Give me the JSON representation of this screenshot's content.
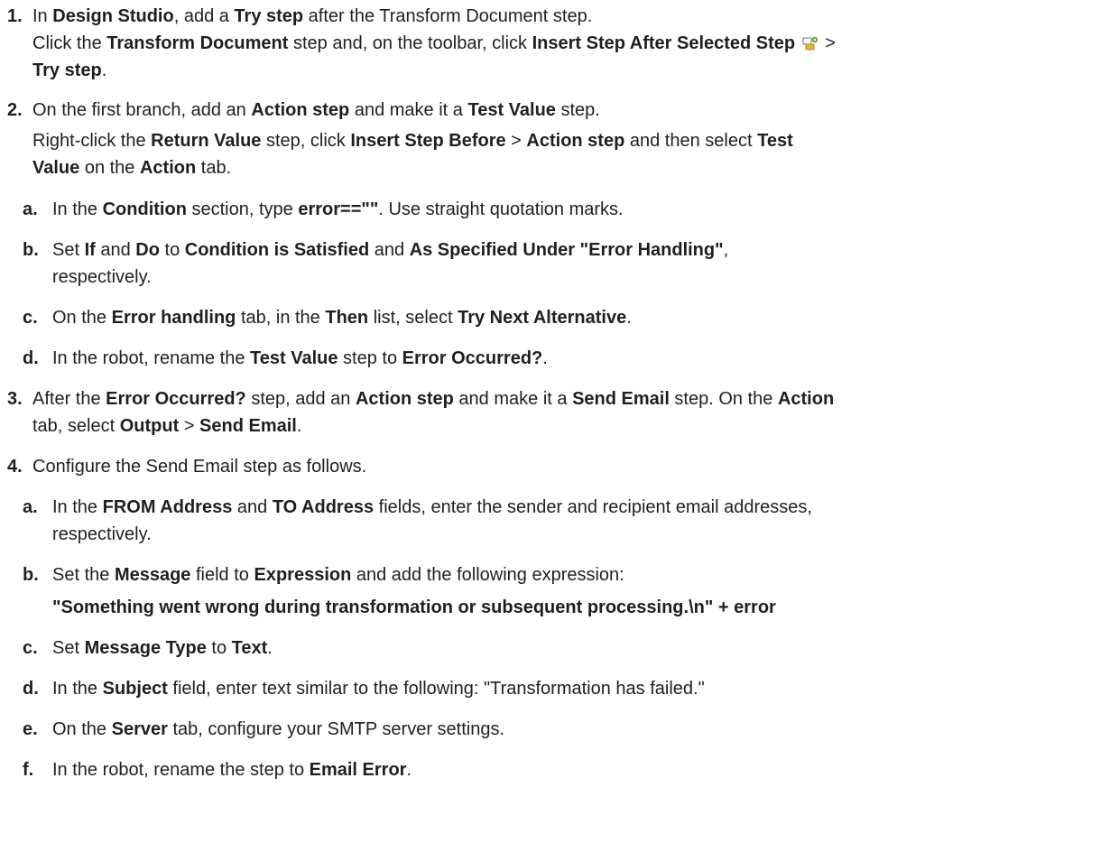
{
  "steps": [
    {
      "num": "1.",
      "line1": [
        "In ",
        "Design Studio",
        ", add a ",
        "Try step",
        " after the Transform Document step."
      ],
      "line2": [
        "Click the ",
        "Transform Document",
        " step and, on the toolbar, click ",
        "Insert Step After Selected Step",
        " ",
        " >"
      ],
      "line3": [
        "Try step",
        "."
      ]
    },
    {
      "num": "2.",
      "line1": [
        "On the first branch, add an ",
        "Action step",
        " and make it a ",
        "Test Value",
        " step."
      ],
      "line2": [
        "Right-click the ",
        "Return Value",
        " step, click ",
        "Insert Step Before",
        " > ",
        "Action step",
        " and then select ",
        "Test"
      ],
      "line3": [
        "Value",
        " on the ",
        "Action",
        " tab."
      ],
      "subs": [
        {
          "letter": "a.",
          "parts": [
            "In the ",
            "Condition",
            " section, type ",
            "error==\"\"",
            ". Use straight quotation marks."
          ]
        },
        {
          "letter": "b.",
          "parts": [
            "Set ",
            "If",
            " and ",
            "Do",
            " to ",
            "Condition is Satisfied",
            " and ",
            "As Specified Under \"Error Handling\"",
            ","
          ],
          "cont": "respectively."
        },
        {
          "letter": "c.",
          "parts": [
            "On the ",
            "Error handling",
            " tab, in the ",
            "Then",
            " list, select ",
            "Try Next Alternative",
            "."
          ]
        },
        {
          "letter": "d.",
          "parts": [
            "In the robot, rename the ",
            "Test Value",
            " step to ",
            "Error Occurred?",
            "."
          ]
        }
      ]
    },
    {
      "num": "3.",
      "line1": [
        "After the ",
        "Error Occurred?",
        " step, add an ",
        "Action step",
        " and make it a ",
        "Send Email",
        " step. On the ",
        "Action"
      ],
      "line2": [
        "tab, select ",
        "Output",
        " > ",
        "Send Email",
        "."
      ]
    },
    {
      "num": "4.",
      "line1": "Configure the Send Email step as follows.",
      "subs": [
        {
          "letter": "a.",
          "parts": [
            "In the ",
            "FROM Address",
            " and ",
            "TO Address",
            " fields, enter the sender and recipient email addresses,"
          ],
          "cont": "respectively."
        },
        {
          "letter": "b.",
          "parts": [
            "Set the ",
            "Message",
            " field to ",
            "Expression",
            " and add the following expression:"
          ],
          "expr": "\"Something went wrong during transformation or subsequent processing.\\n\" + error"
        },
        {
          "letter": "c.",
          "parts": [
            "Set ",
            "Message Type",
            " to ",
            "Text",
            "."
          ]
        },
        {
          "letter": "d.",
          "parts": [
            "In the ",
            "Subject",
            " field, enter text similar to the following: \"Transformation has failed.\""
          ]
        },
        {
          "letter": "e.",
          "parts": [
            "On the ",
            "Server",
            " tab, configure your SMTP server settings."
          ]
        },
        {
          "letter": "f.",
          "parts": [
            "In the robot, rename the step to ",
            "Email Error",
            "."
          ]
        }
      ]
    }
  ],
  "icons": {
    "insert_after": "insert-step-after-icon"
  },
  "colors": {
    "text": "#1f1f1f",
    "icon_green": "#5a9e3a",
    "icon_yellow": "#e8b432"
  }
}
